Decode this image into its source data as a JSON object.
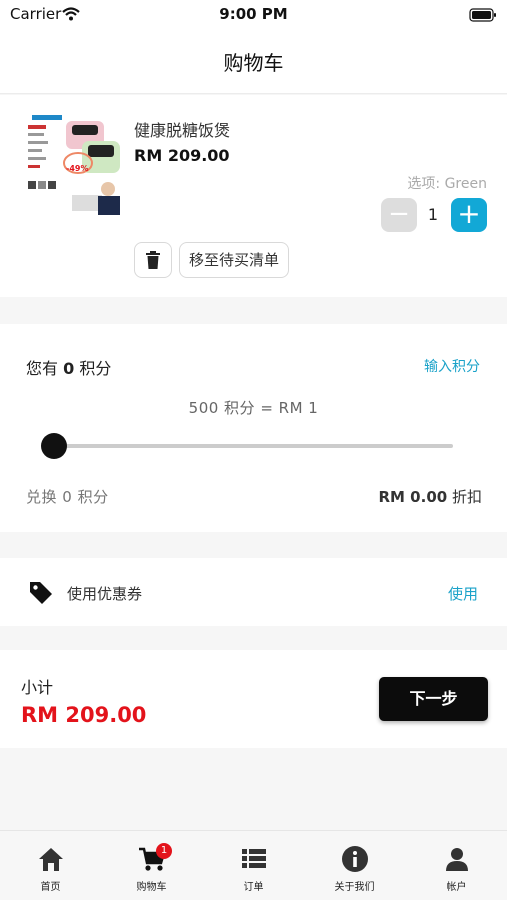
{
  "status_bar": {
    "carrier": "Carrier",
    "time": "9:00 PM"
  },
  "nav": {
    "title": "购物车"
  },
  "cart_item": {
    "name": "健康脱糖饭煲",
    "price": "RM 209.00",
    "option": "选项: Green",
    "quantity": "1",
    "minus_label": "−",
    "plus_label": "+",
    "wishlist_label": "移至待买清单",
    "image_text": {
      "promo": "-49%",
      "promo_color": "#e3131b"
    }
  },
  "points": {
    "title_prefix": "您有",
    "balance": "0",
    "title_suffix": "积分",
    "input_link": "输入积分",
    "rate": "500 积分 = RM 1",
    "redeem_prefix": "兑换",
    "redeem_value": "0",
    "redeem_suffix": "积分",
    "discount_value": "RM 0.00",
    "discount_suffix": "折扣",
    "slider_fraction": 0
  },
  "coupon": {
    "label": "使用优惠券",
    "action": "使用"
  },
  "subtotal": {
    "label": "小计",
    "value": "RM 209.00",
    "next_label": "下一步"
  },
  "tabs": [
    {
      "label": "首页",
      "icon": "home-icon"
    },
    {
      "label": "购物车",
      "icon": "cart-icon",
      "badge": "1"
    },
    {
      "label": "订单",
      "icon": "list-icon"
    },
    {
      "label": "关于我们",
      "icon": "info-icon"
    },
    {
      "label": "帐户",
      "icon": "account-icon"
    }
  ],
  "colors": {
    "accent": "#12a8d6",
    "link": "#1aa2c9",
    "price_red": "#e3131b",
    "primary_button": "#0c0c0c"
  }
}
